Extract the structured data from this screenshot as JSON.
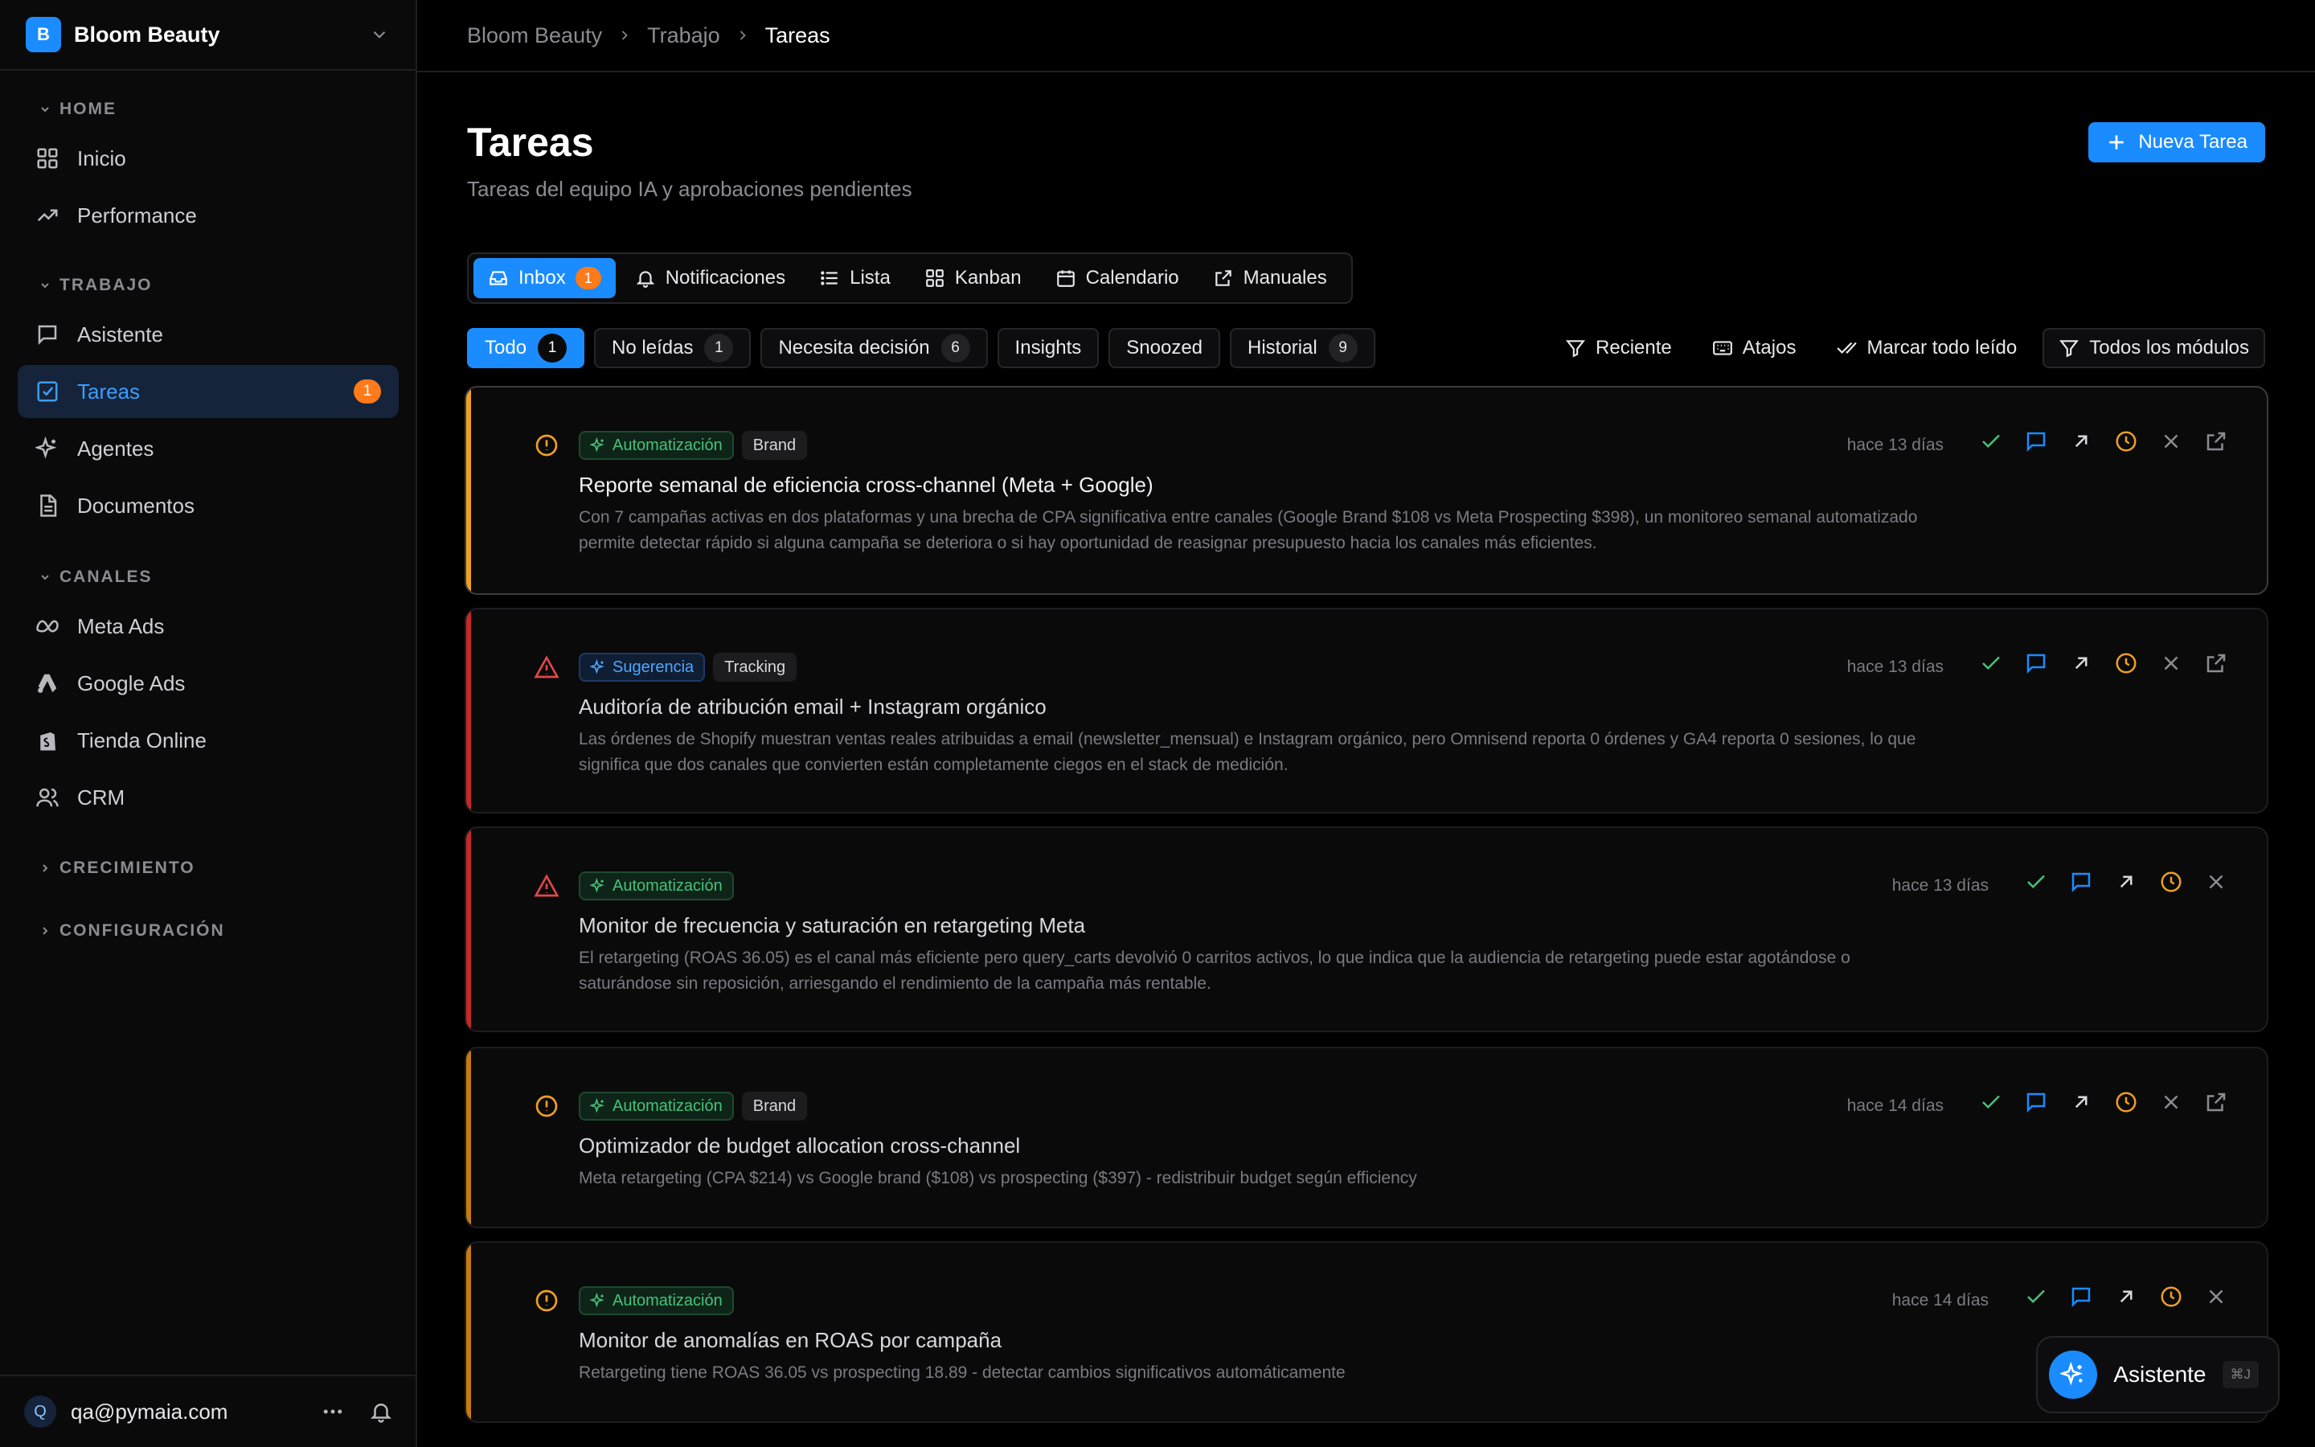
{
  "workspace": {
    "initial": "B",
    "name": "Bloom Beauty"
  },
  "sidebar": {
    "sections": {
      "home": "HOME",
      "trabajo": "TRABAJO",
      "canales": "CANALES",
      "crecimiento": "CRECIMIENTO",
      "configuracion": "CONFIGURACIÓN"
    },
    "items": [
      {
        "label": "Inicio",
        "icon": "grid-icon"
      },
      {
        "label": "Performance",
        "icon": "trend-up-icon"
      },
      {
        "label": "Asistente",
        "icon": "chat-icon"
      },
      {
        "label": "Tareas",
        "icon": "checkbox-icon",
        "badge": "1",
        "active": true
      },
      {
        "label": "Agentes",
        "icon": "sparkles-icon"
      },
      {
        "label": "Documentos",
        "icon": "document-icon"
      },
      {
        "label": "Meta Ads",
        "icon": "meta-icon"
      },
      {
        "label": "Google Ads",
        "icon": "google-ads-icon"
      },
      {
        "label": "Tienda Online",
        "icon": "shopify-icon"
      },
      {
        "label": "CRM",
        "icon": "users-icon"
      }
    ],
    "user": {
      "initial": "Q",
      "email": "qa@pymaia.com"
    }
  },
  "breadcrumb": [
    "Bloom Beauty",
    "Trabajo",
    "Tareas"
  ],
  "page": {
    "title": "Tareas",
    "subtitle": "Tareas del equipo IA y aprobaciones pendientes",
    "new_button": "Nueva Tarea"
  },
  "tabs": [
    {
      "label": "Inbox",
      "badge": "1",
      "active": true
    },
    {
      "label": "Notificaciones"
    },
    {
      "label": "Lista"
    },
    {
      "label": "Kanban"
    },
    {
      "label": "Calendario"
    },
    {
      "label": "Manuales"
    }
  ],
  "filters": [
    {
      "label": "Todo",
      "count": "1",
      "active": true
    },
    {
      "label": "No leídas",
      "count": "1"
    },
    {
      "label": "Necesita decisión",
      "count": "6"
    },
    {
      "label": "Insights"
    },
    {
      "label": "Snoozed"
    },
    {
      "label": "Historial",
      "count": "9"
    }
  ],
  "tools": {
    "reciente": "Reciente",
    "atajos": "Atajos",
    "marcar": "Marcar todo leído",
    "modulos": "Todos los módulos"
  },
  "tasks": [
    {
      "type": "Automatización",
      "tag2": "Brand",
      "accent": "#f0a020",
      "priority": "alert-circle-icon",
      "title": "Reporte semanal de eficiencia cross-channel (Meta + Google)",
      "desc": "Con 7 campañas activas en dos plataformas y una brecha de CPA significativa entre canales (Google Brand $108 vs Meta Prospecting $398), un monitoreo semanal automatizado permite detectar rápido si alguna campaña se deteriora o si hay oportunidad de reasignar presupuesto hacia los canales más eficientes.",
      "time": "hace 13 días"
    },
    {
      "type": "Sugerencia",
      "tag2": "Tracking",
      "accent": "#c62828",
      "priority": "alert-triangle-icon",
      "title": "Auditoría de atribución email + Instagram orgánico",
      "desc": "Las órdenes de Shopify muestran ventas reales atribuidas a email (newsletter_mensual) e Instagram orgánico, pero Omnisend reporta 0 órdenes y GA4 reporta 0 sesiones, lo que significa que dos canales que convierten están completamente ciegos en el stack de medición.",
      "time": "hace 13 días"
    },
    {
      "type": "Automatización",
      "accent": "#c62828",
      "priority": "alert-triangle-icon",
      "title": "Monitor de frecuencia y saturación en retargeting Meta",
      "desc": "El retargeting (ROAS 36.05) es el canal más eficiente pero query_carts devolvió 0 carritos activos, lo que indica que la audiencia de retargeting puede estar agotándose o saturándose sin reposición, arriesgando el rendimiento de la campaña más rentable.",
      "time": "hace 13 días"
    },
    {
      "type": "Automatización",
      "tag2": "Brand",
      "accent": "#c77a10",
      "priority": "alert-circle-icon",
      "title": "Optimizador de budget allocation cross-channel",
      "desc": "Meta retargeting (CPA $214) vs Google brand ($108) vs prospecting ($397) - redistribuir budget según efficiency",
      "time": "hace 14 días"
    },
    {
      "type": "Automatización",
      "accent": "#c77a10",
      "priority": "alert-circle-icon",
      "title": "Monitor de anomalías en ROAS por campaña",
      "desc": "Retargeting tiene ROAS 36.05 vs prospecting 18.89 - detectar cambios significativos automáticamente",
      "time": "hace 14 días"
    }
  ],
  "fab": {
    "label": "Asistente",
    "shortcut": "⌘J"
  },
  "colors": {
    "accent": "#1a8cff",
    "badge": "#ff7a1a",
    "success": "#45c27a",
    "warning": "#f0a020",
    "danger": "#c62828"
  }
}
